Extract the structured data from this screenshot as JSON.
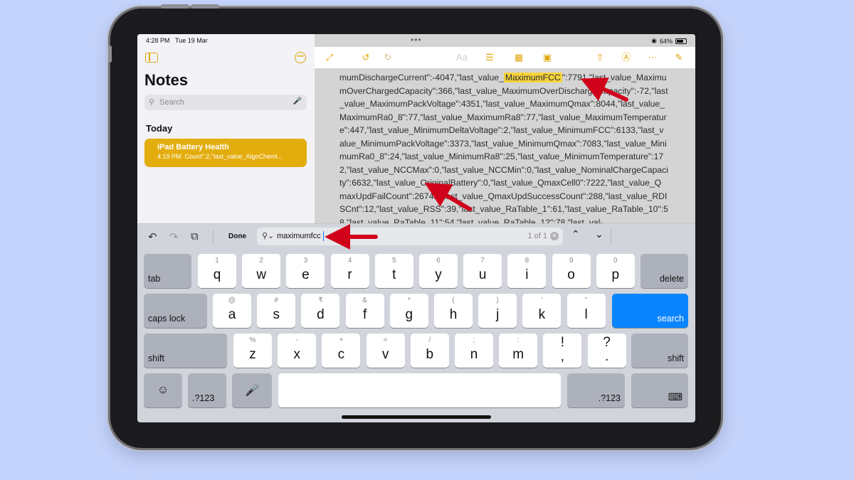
{
  "status": {
    "time": "4:28 PM",
    "date": "Tue 19 Mar",
    "battery": "64%"
  },
  "sidebar": {
    "title": "Notes",
    "search_placeholder": "Search",
    "section": "Today",
    "note": {
      "title": "iPad Battery Health",
      "time": "4:19 PM",
      "preview": "Count\":2,\"last_value_AlgoCheml..."
    }
  },
  "note": {
    "text_before": "mumDischargeCurrent\":-4047,\"last_value_",
    "highlight": "MaximumFCC",
    "text_after": "\":7791,\"last_value_MaximumOverChargedCapacity\":366,\"last_value_MaximumOverDischargeCapacity\":-72,\"last_value_MaximumPackVoltage\":4351,\"last_value_MaximumQmax\":8044,\"last_value_MaximumRa0_8\":77,\"last_value_MaximumRa8\":77,\"last_value_MaximumTemperature\":447,\"last_value_MinimumDeltaVoltage\":2,\"last_value_MinimumFCC\":6133,\"last_value_MinimumPackVoltage\":3373,\"last_value_MinimumQmax\":7083,\"last_value_MinimumRa0_8\":24,\"last_value_MinimumRa8\":25,\"last_value_MinimumTemperature\":172,\"last_value_NCCMax\":0,\"last_value_NCCMin\":0,\"last_value_NominalChargeCapacity\":6632,\"last_value_OriginalBattery\":0,\"last_value_QmaxCell0\":7222,\"last_value_QmaxUpdFailCount\":26745,\"last_value_QmaxUpdSuccessCount\":288,\"last_value_RDISCnt\":12,\"last_value_RSS\":39,\"last_value_RaTable_1\":61,\"last_value_RaTable_10\":58,\"last_value_RaTable_11\":54,\"last_value_RaTable_12\":78,\"last_val-"
  },
  "find": {
    "done_label": "Done",
    "query": "maximumfcc",
    "count": "1 of 1"
  },
  "keyboard": {
    "row1_left": "tab",
    "row1": [
      {
        "k": "q",
        "a": "1"
      },
      {
        "k": "w",
        "a": "2"
      },
      {
        "k": "e",
        "a": "3"
      },
      {
        "k": "r",
        "a": "4"
      },
      {
        "k": "t",
        "a": "5"
      },
      {
        "k": "y",
        "a": "6"
      },
      {
        "k": "u",
        "a": "7"
      },
      {
        "k": "i",
        "a": "8"
      },
      {
        "k": "o",
        "a": "9"
      },
      {
        "k": "p",
        "a": "0"
      }
    ],
    "row1_right": "delete",
    "row2_left": "caps lock",
    "row2": [
      {
        "k": "a",
        "a": "@"
      },
      {
        "k": "s",
        "a": "#"
      },
      {
        "k": "d",
        "a": "₹"
      },
      {
        "k": "f",
        "a": "&"
      },
      {
        "k": "g",
        "a": "*"
      },
      {
        "k": "h",
        "a": "("
      },
      {
        "k": "j",
        "a": ")"
      },
      {
        "k": "k",
        "a": "'"
      },
      {
        "k": "l",
        "a": "\""
      }
    ],
    "row2_right": "search",
    "row3_left": "shift",
    "row3": [
      {
        "k": "z",
        "a": "%"
      },
      {
        "k": "x",
        "a": "-"
      },
      {
        "k": "c",
        "a": "+"
      },
      {
        "k": "v",
        "a": "="
      },
      {
        "k": "b",
        "a": "/"
      },
      {
        "k": "n",
        "a": ";"
      },
      {
        "k": "m",
        "a": ":"
      },
      {
        "k": ",",
        "a": "!"
      },
      {
        "k": ".",
        "a": "?"
      }
    ],
    "row3_right": "shift",
    "numbers_label": ".?123",
    "icons": {
      "emoji": "emoji-icon",
      "mic": "microphone-icon",
      "hide": "keyboard-hide-icon"
    }
  },
  "colors": {
    "accent": "#e2a70d",
    "search_key": "#0a84ff",
    "arrow": "#d0021b",
    "highlight": "#f6d33c"
  }
}
